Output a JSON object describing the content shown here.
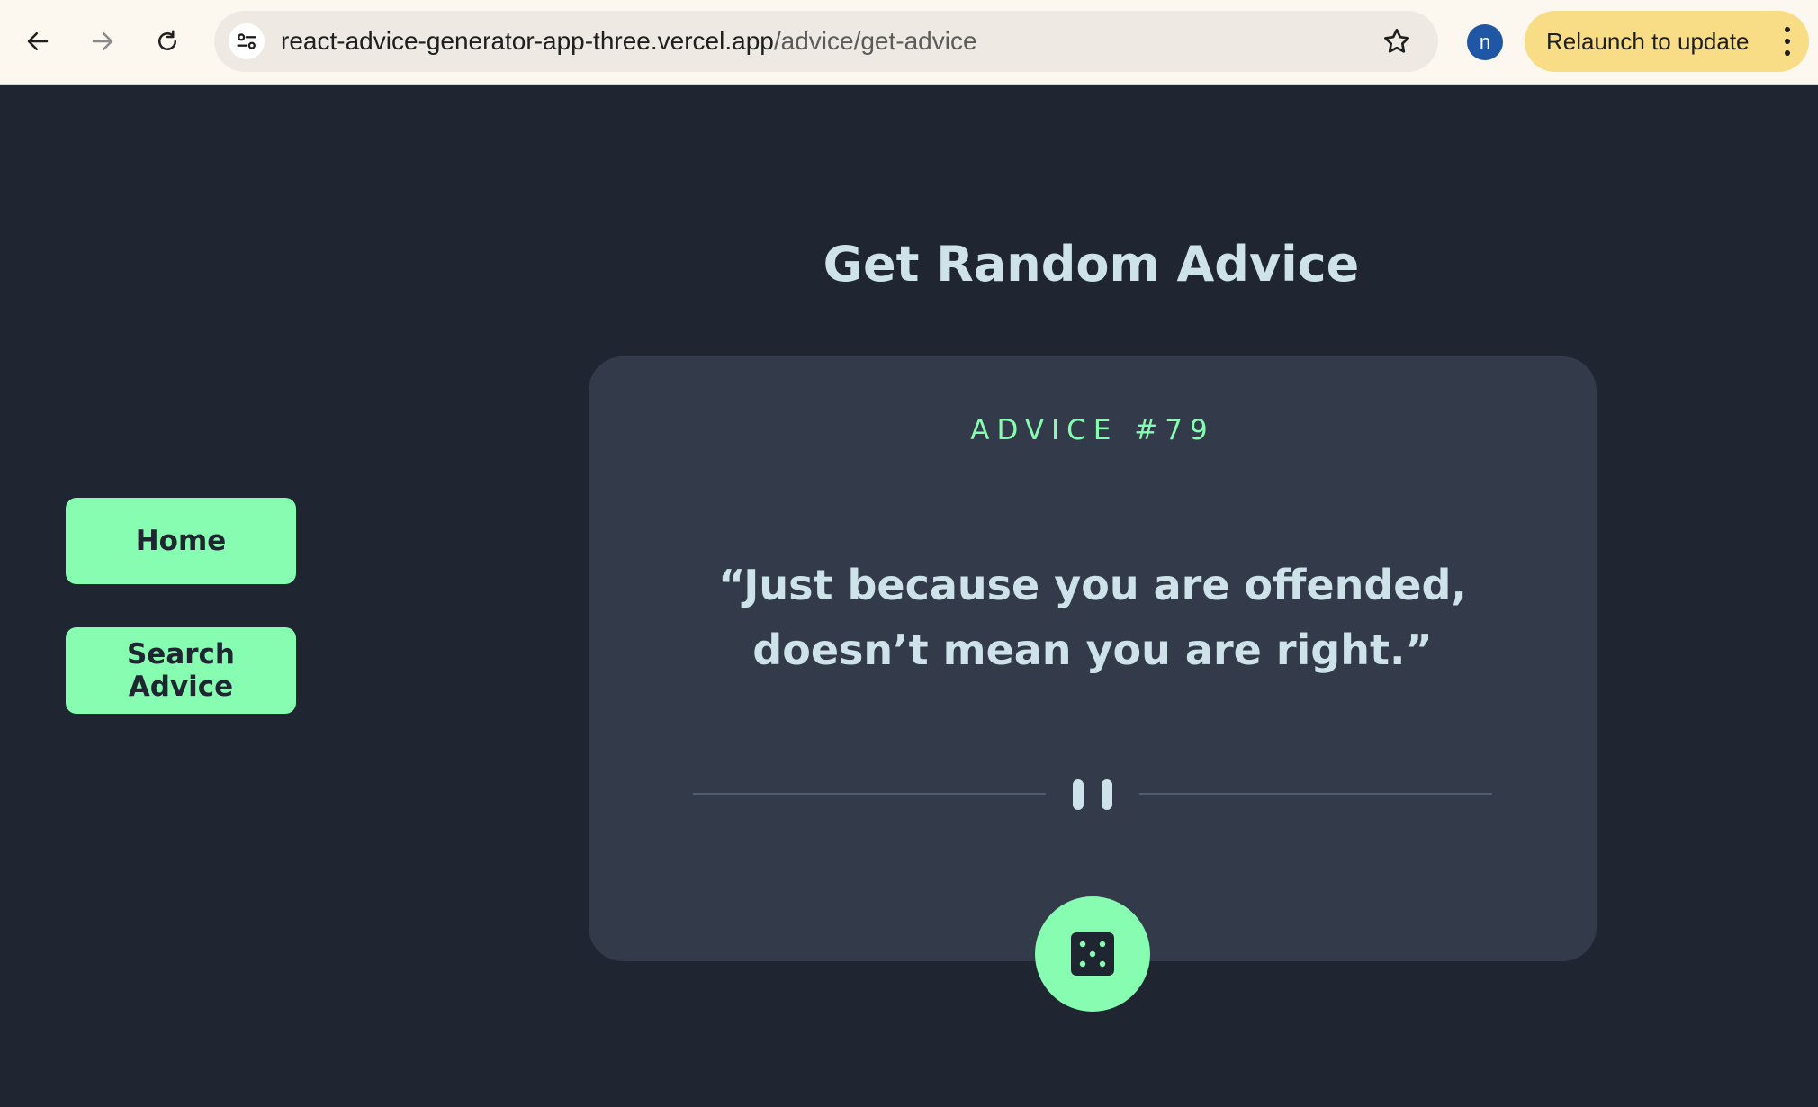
{
  "browser": {
    "url_host": "react-advice-generator-app-three.vercel.app",
    "url_path": "/advice/get-advice",
    "profile_initial": "n",
    "relaunch_label": "Relaunch to update"
  },
  "page": {
    "title": "Get Random Advice"
  },
  "sidebar": {
    "items": [
      {
        "label": "Home"
      },
      {
        "label": "Search Advice"
      }
    ]
  },
  "advice": {
    "id_label": "ADVICE #79",
    "text": "“Just because you are offended, doesn’t mean you are right.”"
  },
  "colors": {
    "background": "#1f2632",
    "card": "#333a4a",
    "accent": "#86fdb0",
    "text": "#cee3e9"
  },
  "icons": {
    "back": "arrow-left-icon",
    "forward": "arrow-right-icon",
    "reload": "reload-icon",
    "site_info": "tune-icon",
    "bookmark": "star-icon",
    "menu": "kebab-menu-icon",
    "divider": "pause-icon",
    "generate": "dice-icon"
  }
}
